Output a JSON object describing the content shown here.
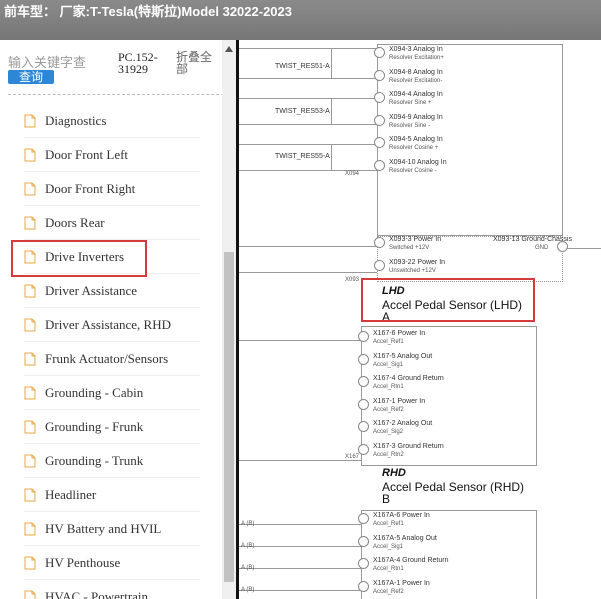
{
  "titlebar": {
    "text": "前车型：  厂家:T-Tesla(特斯拉)Model 32022-2023"
  },
  "search": {
    "placeholder": "输入关键字查",
    "button": "查询",
    "pc_label": "PC.152-31929",
    "collapse": "折叠全部"
  },
  "sidebar": {
    "items": [
      {
        "label": "Diagnostics"
      },
      {
        "label": "Door Front Left"
      },
      {
        "label": "Door Front Right"
      },
      {
        "label": "Doors Rear"
      },
      {
        "label": "Drive Inverters"
      },
      {
        "label": "Driver Assistance"
      },
      {
        "label": "Driver Assistance, RHD"
      },
      {
        "label": "Frunk Actuator/Sensors"
      },
      {
        "label": "Grounding - Cabin"
      },
      {
        "label": "Grounding - Frunk"
      },
      {
        "label": "Grounding - Trunk"
      },
      {
        "label": "Headliner"
      },
      {
        "label": "HV Battery and HVIL"
      },
      {
        "label": "HV Penthouse"
      },
      {
        "label": "HVAC - Powertrain"
      }
    ]
  },
  "diagram": {
    "twists": [
      "TWIST_RES51-A",
      "TWIST_RES53-A",
      "TWIST_RES55-A"
    ],
    "x094_label": "X094",
    "x094_pins": [
      {
        "name": "X094-3 Analog In",
        "sub": "Resolver Excitation+"
      },
      {
        "name": "X094-8 Analog In",
        "sub": "Resolver Excitation-"
      },
      {
        "name": "X094-4 Analog In",
        "sub": "Resolver Sine +"
      },
      {
        "name": "X094-9 Analog In",
        "sub": "Resolver Sine -"
      },
      {
        "name": "X094-5 Analog In",
        "sub": "Resolver Cosine +"
      },
      {
        "name": "X094-10 Analog In",
        "sub": "Resolver Cosine -"
      }
    ],
    "x093_pins": [
      {
        "name": "X093-3 Power In",
        "sub": "Switched +12V"
      },
      {
        "name": "X093-22 Power In",
        "sub": "Unswitched +12V"
      }
    ],
    "x093_ground": {
      "name": "X093-13 Ground-Chassis",
      "sub": "GND"
    },
    "x093_label": "X093",
    "lhd": {
      "tag": "LHD",
      "title": "Accel Pedal Sensor (LHD)",
      "sub": "A"
    },
    "x167_label": "X167",
    "x167_pins": [
      {
        "name": "X167-6 Power In",
        "sub": "Accel_Ref1"
      },
      {
        "name": "X167-5 Analog Out",
        "sub": "Accel_Sig1"
      },
      {
        "name": "X167-4 Ground Return",
        "sub": "Accel_Rtn1"
      },
      {
        "name": "X167-1 Power In",
        "sub": "Accel_Ref2"
      },
      {
        "name": "X167-2 Analog Out",
        "sub": "Accel_Sig2"
      },
      {
        "name": "X167-3 Ground Return",
        "sub": "Accel_Rtn2"
      }
    ],
    "rhd": {
      "tag": "RHD",
      "title": "Accel Pedal Sensor (RHD)",
      "sub": "B"
    },
    "x167a_pins": [
      {
        "name": "X167A-6 Power In",
        "sub": "Accel_Ref1"
      },
      {
        "name": "X167A-5 Analog Out",
        "sub": "Accel_Sig1"
      },
      {
        "name": "X167A-4 Ground Return",
        "sub": "Accel_Rtn1"
      },
      {
        "name": "X167A-1 Power In",
        "sub": "Accel_Ref2"
      }
    ],
    "a_b": [
      "A (B)",
      "A (B)",
      "A (B)",
      "A (B)"
    ]
  }
}
